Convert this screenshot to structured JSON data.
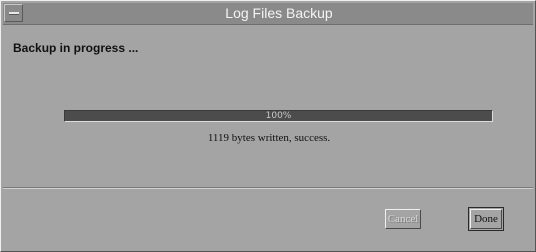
{
  "window": {
    "title": "Log Files Backup"
  },
  "status": {
    "message": "Backup in progress ..."
  },
  "progress": {
    "value_percent": 100,
    "label": "100%"
  },
  "result": {
    "message": "1119 bytes written, success."
  },
  "buttons": {
    "cancel_label": "Cancel",
    "cancel_enabled": false,
    "done_label": "Done",
    "done_enabled": true
  },
  "colors": {
    "background": "#a4a4a4",
    "titlebar": "#8a8a8a",
    "progress_fill": "#4c4c4c"
  }
}
